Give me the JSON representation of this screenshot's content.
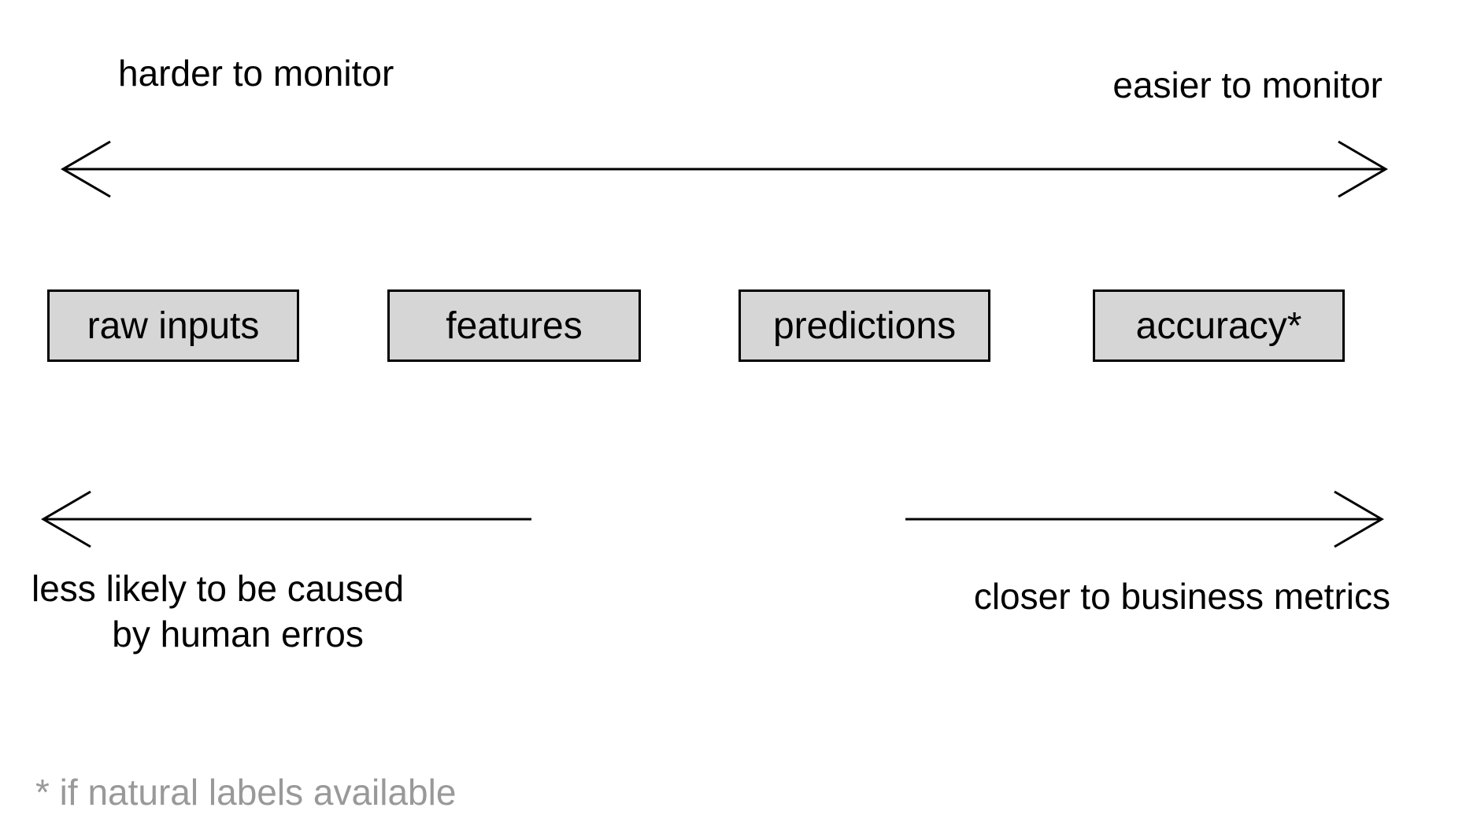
{
  "top": {
    "left_label": "harder to monitor",
    "right_label": "easier to monitor"
  },
  "boxes": [
    "raw inputs",
    "features",
    "predictions",
    "accuracy*"
  ],
  "bottom": {
    "left_label": "less likely to be caused\n        by human erros",
    "right_label": "closer to business metrics"
  },
  "footnote": "* if natural labels available"
}
